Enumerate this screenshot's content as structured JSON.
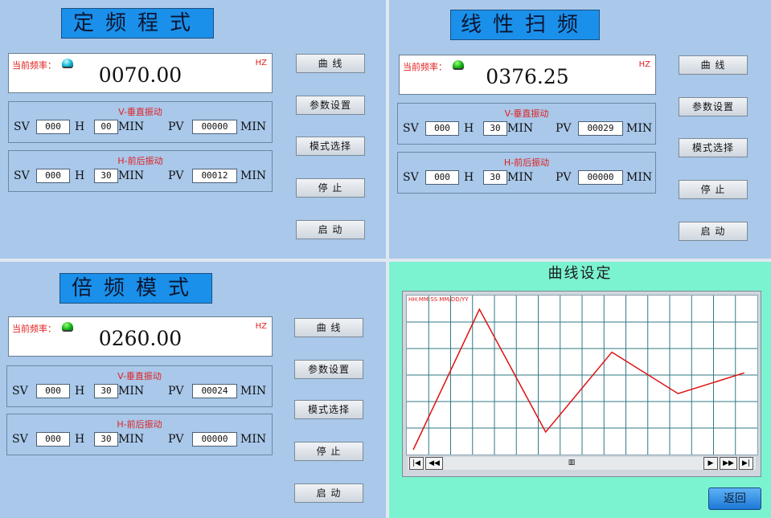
{
  "panels": [
    {
      "title": "定频程式",
      "freq_label": "当前频率：",
      "led": "cyan",
      "freq_value": "0070.00",
      "unit": "HZ",
      "v_title": "V-垂直振动",
      "h_title": "H-前后振动",
      "v": {
        "sv_label": "SV",
        "sv": "000",
        "h_label": "H",
        "min": "00",
        "min_label": "MIN",
        "pv_label": "PV",
        "pv": "00000",
        "pv_unit": "MIN"
      },
      "hrow": {
        "sv_label": "SV",
        "sv": "000",
        "h_label": "H",
        "min": "30",
        "min_label": "MIN",
        "pv_label": "PV",
        "pv": "00012",
        "pv_unit": "MIN"
      },
      "buttons": [
        "曲 线",
        "参数设置",
        "模式选择",
        "停 止",
        "启 动"
      ]
    },
    {
      "title": "线性扫频",
      "freq_label": "当前频率：",
      "led": "green",
      "freq_value": "0376.25",
      "unit": "HZ",
      "v_title": "V-垂直振动",
      "h_title": "H-前后振动",
      "v": {
        "sv_label": "SV",
        "sv": "000",
        "h_label": "H",
        "min": "30",
        "min_label": "MIN",
        "pv_label": "PV",
        "pv": "00029",
        "pv_unit": "MIN"
      },
      "hrow": {
        "sv_label": "SV",
        "sv": "000",
        "h_label": "H",
        "min": "30",
        "min_label": "MIN",
        "pv_label": "PV",
        "pv": "00000",
        "pv_unit": "MIN"
      },
      "buttons": [
        "曲 线",
        "参数设置",
        "模式选择",
        "停 止",
        "启 动"
      ]
    },
    {
      "title": "倍频模式",
      "freq_label": "当前频率：",
      "led": "green",
      "freq_value": "0260.00",
      "unit": "HZ",
      "v_title": "V-垂直振动",
      "h_title": "H-前后振动",
      "v": {
        "sv_label": "SV",
        "sv": "000",
        "h_label": "H",
        "min": "30",
        "min_label": "MIN",
        "pv_label": "PV",
        "pv": "00024",
        "pv_unit": "MIN"
      },
      "hrow": {
        "sv_label": "SV",
        "sv": "000",
        "h_label": "H",
        "min": "30",
        "min_label": "MIN",
        "pv_label": "PV",
        "pv": "00000",
        "pv_unit": "MIN"
      },
      "buttons": [
        "曲 线",
        "参数设置",
        "模式选择",
        "停 止",
        "启 动"
      ]
    }
  ],
  "curve": {
    "title": "曲线设定",
    "time_format": "HH:MM:SS MM/DD/YY",
    "return_label": "返回",
    "scroll_buttons": [
      "first-icon",
      "prev-icon",
      "pause-icon",
      "next-icon",
      "fast-forward-icon",
      "last-icon"
    ],
    "line_color": "#e01010"
  },
  "chart_data": {
    "type": "line",
    "x": [
      0,
      1,
      2,
      3,
      4,
      5
    ],
    "y": [
      0,
      0.95,
      0.12,
      0.66,
      0.38,
      0.52
    ],
    "grid": true,
    "xlim": [
      0,
      5.1
    ],
    "ylim": [
      0,
      1
    ]
  },
  "colors": {
    "panel_blue": "#a9c8ea",
    "panel_green": "#7cf3d0",
    "title_blue": "#1a90ea",
    "label_red": "#e02020"
  }
}
